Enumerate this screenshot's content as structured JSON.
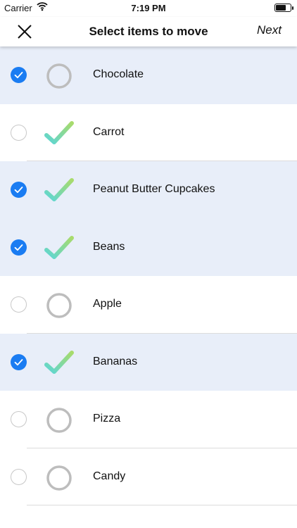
{
  "status_bar": {
    "carrier": "Carrier",
    "time": "7:19 PM"
  },
  "nav": {
    "title": "Select items to move",
    "next_label": "Next"
  },
  "colors": {
    "selected_row": "#e8eef9",
    "accent": "#1a7cf2",
    "ring": "#bdbdbd"
  },
  "items": [
    {
      "label": "Chocolate",
      "selected": true,
      "done": false
    },
    {
      "label": "Carrot",
      "selected": false,
      "done": true
    },
    {
      "label": "Peanut Butter Cupcakes",
      "selected": true,
      "done": true
    },
    {
      "label": "Beans",
      "selected": true,
      "done": true
    },
    {
      "label": "Apple",
      "selected": false,
      "done": false
    },
    {
      "label": "Bananas",
      "selected": true,
      "done": true
    },
    {
      "label": "Pizza",
      "selected": false,
      "done": false
    },
    {
      "label": "Candy",
      "selected": false,
      "done": false
    }
  ]
}
